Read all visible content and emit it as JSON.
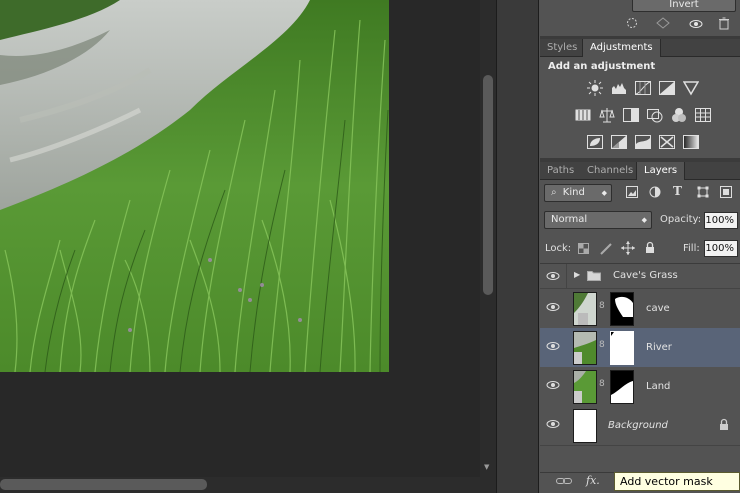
{
  "adjustments_panel": {
    "invert_label": "Invert",
    "tabs": [
      "Styles",
      "Adjustments"
    ],
    "active_tab": "Adjustments",
    "heading": "Add an adjustment"
  },
  "layers_panel": {
    "tabs": [
      "Paths",
      "Channels",
      "Layers"
    ],
    "active_tab": "Layers",
    "filter_kind": "Kind",
    "blend_mode": "Normal",
    "opacity_label": "Opacity:",
    "opacity_value": "100%",
    "lock_label": "Lock:",
    "fill_label": "Fill:",
    "fill_value": "100%",
    "layers": [
      {
        "name": "Cave's Grass",
        "type": "group",
        "selected": false
      },
      {
        "name": "cave",
        "type": "masked",
        "selected": false
      },
      {
        "name": "River",
        "type": "masked",
        "selected": true
      },
      {
        "name": "Land",
        "type": "masked",
        "selected": false
      },
      {
        "name": "Background",
        "type": "background",
        "selected": false,
        "locked": true
      }
    ]
  },
  "tooltip": {
    "text": "Add vector mask"
  },
  "icons": [
    "eye-icon",
    "trash-icon",
    "link-icon",
    "fx-icon",
    "folder-icon",
    "lock-icon",
    "search-icon",
    "chevron-right-icon"
  ]
}
